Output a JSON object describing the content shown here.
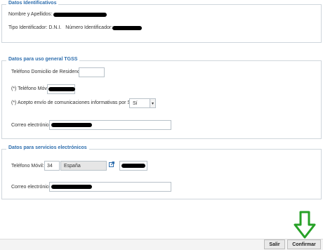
{
  "section1": {
    "legend": "Datos  Identificativos",
    "name_label": "Nombre y Apellidos:",
    "id_type_label": "Tipo Identificador: D.N.I.",
    "id_number_label": "Número Identificador:"
  },
  "section2": {
    "legend": "Datos para uso general TGSS",
    "home_phone_label": "Teléfono Domicilio de Residencia:",
    "mobile_label": "(*) Teléfono Móvil:",
    "sms_label": "(*) Acepto envío de comunicaciones informativas por SMS:",
    "sms_value": "Sí",
    "email_label": "Correo electrónico:"
  },
  "section3": {
    "legend": "Datos para servicios electrónicos",
    "mobile_label": "Teléfono Móvil: +",
    "prefix_value": "34",
    "country_value": "España",
    "email_label": "Correo electrónico:"
  },
  "footer": {
    "exit_label": "Salir",
    "confirm_label": "Confirmar"
  },
  "colors": {
    "legend": "#2f6fae",
    "arrow": "#27a127"
  },
  "icons": {
    "external": "external-link-icon",
    "arrow": "arrow-down-icon",
    "caret": "chevron-down-icon"
  }
}
